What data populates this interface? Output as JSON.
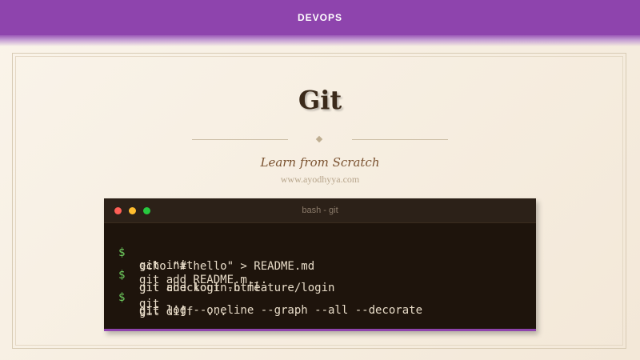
{
  "header": {
    "brand": "DEVOPS"
  },
  "hero": {
    "title": "Git",
    "subtitle": "Learn from Scratch",
    "url": "www.ayodhyya.com"
  },
  "terminal": {
    "title": "bash - git",
    "prompt": "$",
    "lines": [
      {
        "prompt": "$",
        "text": "git init"
      },
      {
        "prompt": "",
        "text": "echo \"# hello\" > README.md"
      },
      {
        "prompt": "$",
        "text": "git checkout -b feature/login"
      },
      {
        "prompt": "",
        "text": "git add README.m..."
      },
      {
        "prompt": "",
        "text": "git add login.html"
      },
      {
        "prompt": "$",
        "text": "git log --oneline --graph --all --decorate"
      },
      {
        "prompt": "",
        "text": "git ..."
      },
      {
        "prompt": "",
        "text": "git diff  ..."
      }
    ],
    "colors": {
      "prompt": "#6fce5f",
      "accent": "#8e44ad",
      "background": "#1e140c"
    }
  },
  "colors": {
    "header": "#8e44ad",
    "title": "#3b2a1a",
    "subtitle": "#7a5230"
  }
}
